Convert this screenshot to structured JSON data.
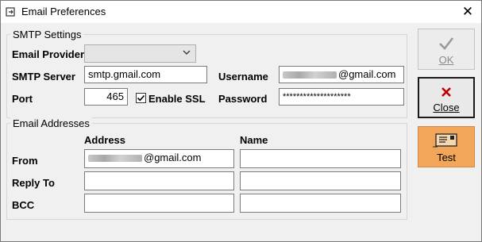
{
  "window": {
    "title": "Email Preferences",
    "close_glyph": "✕"
  },
  "smtp": {
    "group_label": "SMTP Settings",
    "provider_label": "Email Provider",
    "provider_value": "",
    "server_label": "SMTP Server",
    "server_value": "smtp.gmail.com",
    "port_label": "Port",
    "port_value": "465",
    "ssl_label": "Enable SSL",
    "ssl_checked": true,
    "username_label": "Username",
    "username_value": "@gmail.com",
    "password_label": "Password",
    "password_value": "********************"
  },
  "addresses": {
    "group_label": "Email Addresses",
    "col_address": "Address",
    "col_name": "Name",
    "rows": [
      {
        "label": "From",
        "address": "@gmail.com",
        "name": ""
      },
      {
        "label": "Reply To",
        "address": "",
        "name": ""
      },
      {
        "label": "BCC",
        "address": "",
        "name": ""
      }
    ]
  },
  "buttons": {
    "ok_label": "OK",
    "close_label": "Close",
    "test_label": "Test"
  },
  "colors": {
    "test_bg": "#f2a65a",
    "close_icon": "#c00000",
    "focus_border": "#1a1a1a"
  },
  "icons": {
    "ok": "checkmark-icon",
    "close": "x-icon",
    "test": "envelope-icon"
  }
}
